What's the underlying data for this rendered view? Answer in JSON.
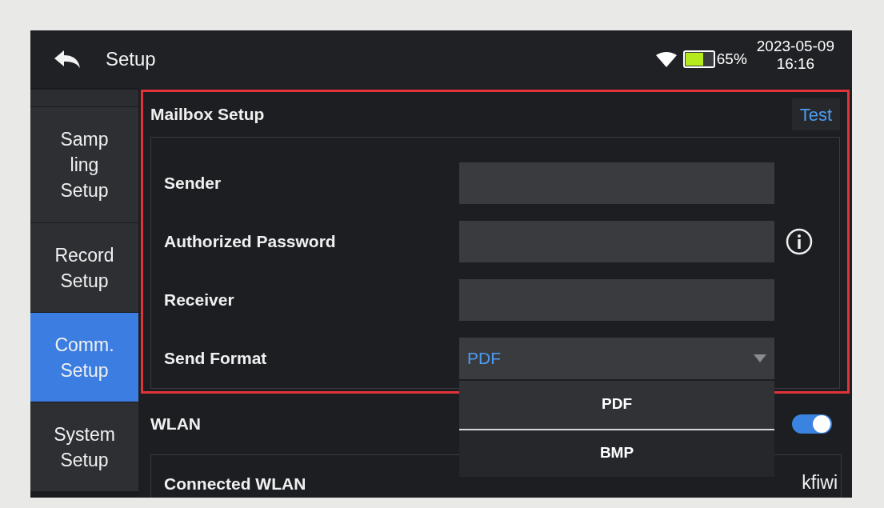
{
  "header": {
    "title": "Setup",
    "battery": {
      "level": 0.65
    },
    "battery_text": "65%",
    "date": "2023-05-09",
    "time": "16:16"
  },
  "sidebar": {
    "items": [
      {
        "label": "Samp\nling\nSetup",
        "selected": false
      },
      {
        "label": "Record\nSetup",
        "selected": false
      },
      {
        "label": "Comm.\nSetup",
        "selected": true
      },
      {
        "label": "System\nSetup",
        "selected": false
      }
    ]
  },
  "mailbox": {
    "title": "Mailbox Setup",
    "highlighted": true,
    "test_button": "Test",
    "fields": [
      {
        "kind": "input",
        "label": "Sender"
      },
      {
        "kind": "input",
        "label": "Authorized Password"
      },
      {
        "kind": "input",
        "label": "Receiver"
      },
      {
        "kind": "select",
        "label": "Send Format",
        "value": "PDF",
        "open": true
      }
    ],
    "dropdown_options": [
      {
        "label": "PDF",
        "selected": true
      },
      {
        "label": "BMP",
        "selected": false
      }
    ]
  },
  "wlan": {
    "title": "WLAN",
    "on": true,
    "connected_label": "Connected WLAN",
    "connected_value": "kfiwi"
  }
}
